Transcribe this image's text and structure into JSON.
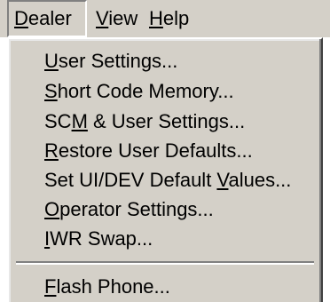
{
  "menubar": {
    "items": [
      {
        "label": "Dealer",
        "mnemonic_index": 0,
        "open": true
      },
      {
        "label": "View",
        "mnemonic_index": 0,
        "open": false
      },
      {
        "label": "Help",
        "mnemonic_index": 0,
        "open": false
      }
    ]
  },
  "dealer_menu": {
    "items": [
      {
        "label": "User Settings...",
        "mnemonic_index": 0
      },
      {
        "label": "Short Code Memory...",
        "mnemonic_index": 0
      },
      {
        "label": "SCM & User Settings...",
        "mnemonic_index": 2
      },
      {
        "label": "Restore User Defaults...",
        "mnemonic_index": 0
      },
      {
        "label": "Set UI/DEV Default Values...",
        "mnemonic_index": 19
      },
      {
        "label": "Operator Settings...",
        "mnemonic_index": 0
      },
      {
        "label": "IWR Swap...",
        "mnemonic_index": 0
      },
      {
        "separator": true
      },
      {
        "label": "Flash Phone...",
        "mnemonic_index": 0
      }
    ]
  },
  "colors": {
    "menu_background": "#d4d0c8",
    "page_background": "#ffffff",
    "text": "#000000"
  }
}
